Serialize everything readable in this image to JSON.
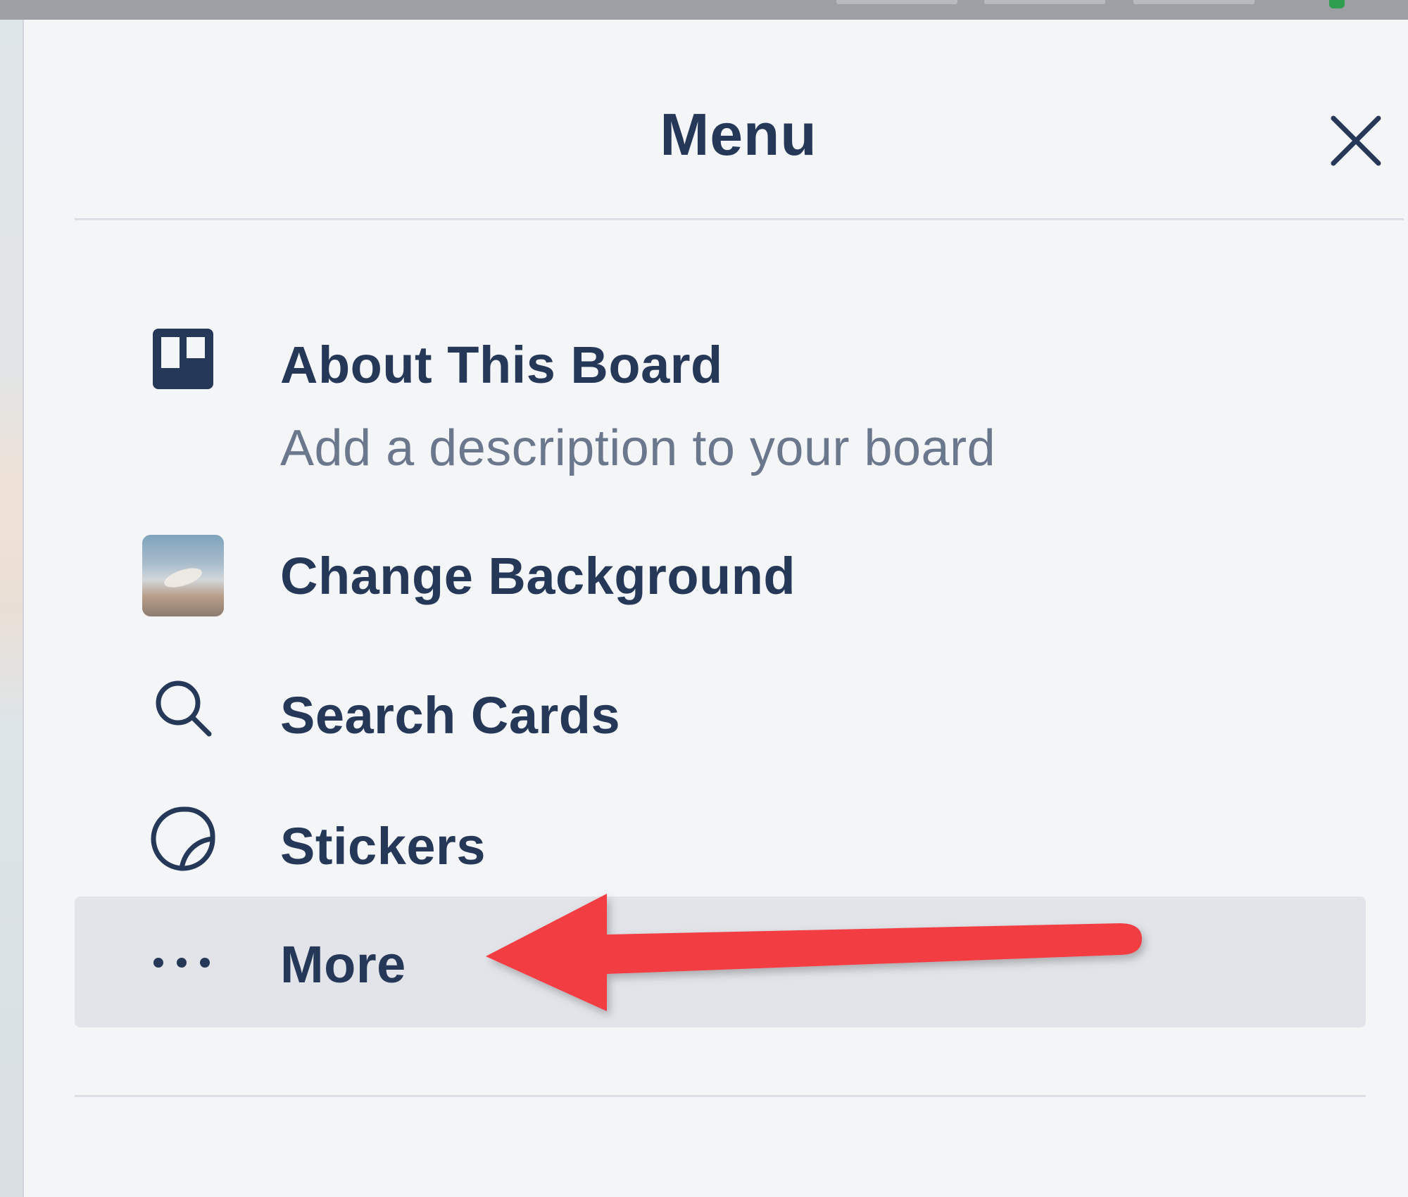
{
  "panel": {
    "title": "Menu",
    "close_icon": "close-icon"
  },
  "menu_items": [
    {
      "label": "About This Board",
      "sublabel": "Add a description to your board",
      "icon": "board-icon"
    },
    {
      "label": "Change Background",
      "icon": "background-thumbnail"
    },
    {
      "label": "Search Cards",
      "icon": "search-icon"
    },
    {
      "label": "Stickers",
      "icon": "sticker-icon"
    },
    {
      "label": "More",
      "icon": "more-dots-icon",
      "highlighted": true
    }
  ],
  "colors": {
    "text_primary": "#253858",
    "text_secondary": "#6b778c",
    "panel_bg": "#f4f5f7",
    "highlight_bg": "#e2e4e9",
    "annotation_arrow": "#f23c43"
  },
  "annotation": {
    "arrow_icon": "red-arrow-pointing-left"
  }
}
